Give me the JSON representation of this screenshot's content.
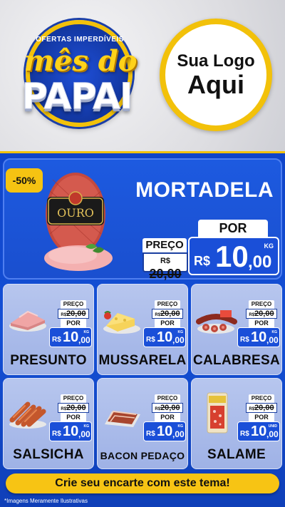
{
  "campaign": {
    "kicker": "OFERTAS IMPERDÍVEIS",
    "line1": "mês do",
    "line2": "PAPAI"
  },
  "logo": {
    "line1": "Sua Logo",
    "line2": "Aqui"
  },
  "featured": {
    "discount": "-50%",
    "name": "MORTADELA",
    "preco_label": "PREÇO",
    "old_currency": "R$",
    "old_price": "20,00",
    "por_label": "POR",
    "new_currency": "R$",
    "new_int": "10",
    "new_dec": ",00",
    "unit": "KG"
  },
  "products": [
    {
      "name": "PRESUNTO",
      "preco_label": "PREÇO",
      "old_currency": "R$",
      "old_price": "20,00",
      "por_label": "POR",
      "new_currency": "R$",
      "new_int": "10",
      "new_dec": ",00",
      "unit": "KG"
    },
    {
      "name": "MUSSARELA",
      "preco_label": "PREÇO",
      "old_currency": "R$",
      "old_price": "20,00",
      "por_label": "POR",
      "new_currency": "R$",
      "new_int": "10",
      "new_dec": ",00",
      "unit": "KG"
    },
    {
      "name": "CALABRESA",
      "preco_label": "PREÇO",
      "old_currency": "R$",
      "old_price": "20,00",
      "por_label": "POR",
      "new_currency": "R$",
      "new_int": "10",
      "new_dec": ",00",
      "unit": "KG"
    },
    {
      "name": "SALSICHA",
      "preco_label": "PREÇO",
      "old_currency": "R$",
      "old_price": "20,00",
      "por_label": "POR",
      "new_currency": "R$",
      "new_int": "10",
      "new_dec": ",00",
      "unit": "KG"
    },
    {
      "name": "BACON PEDAÇO",
      "preco_label": "PREÇO",
      "old_currency": "R$",
      "old_price": "20,00",
      "por_label": "POR",
      "new_currency": "R$",
      "new_int": "10",
      "new_dec": ",00",
      "unit": "KG"
    },
    {
      "name": "SALAME",
      "preco_label": "PREÇO",
      "old_currency": "R$",
      "old_price": "20,00",
      "por_label": "POR",
      "new_currency": "R$",
      "new_int": "10",
      "new_dec": ",00",
      "unit": "UNID"
    }
  ],
  "cta": "Crie seu encarte com este tema!",
  "disclaimer": "*Imagens Meramente Ilustrativas",
  "colors": {
    "blue": "#1a4fd8",
    "yellow": "#f5c312",
    "card": "#aebfeb"
  },
  "icons": [
    "mortadela-product-image",
    "presunto-product-image",
    "mussarela-product-image",
    "calabresa-product-image",
    "salsicha-product-image",
    "bacon-product-image",
    "salame-product-image"
  ]
}
